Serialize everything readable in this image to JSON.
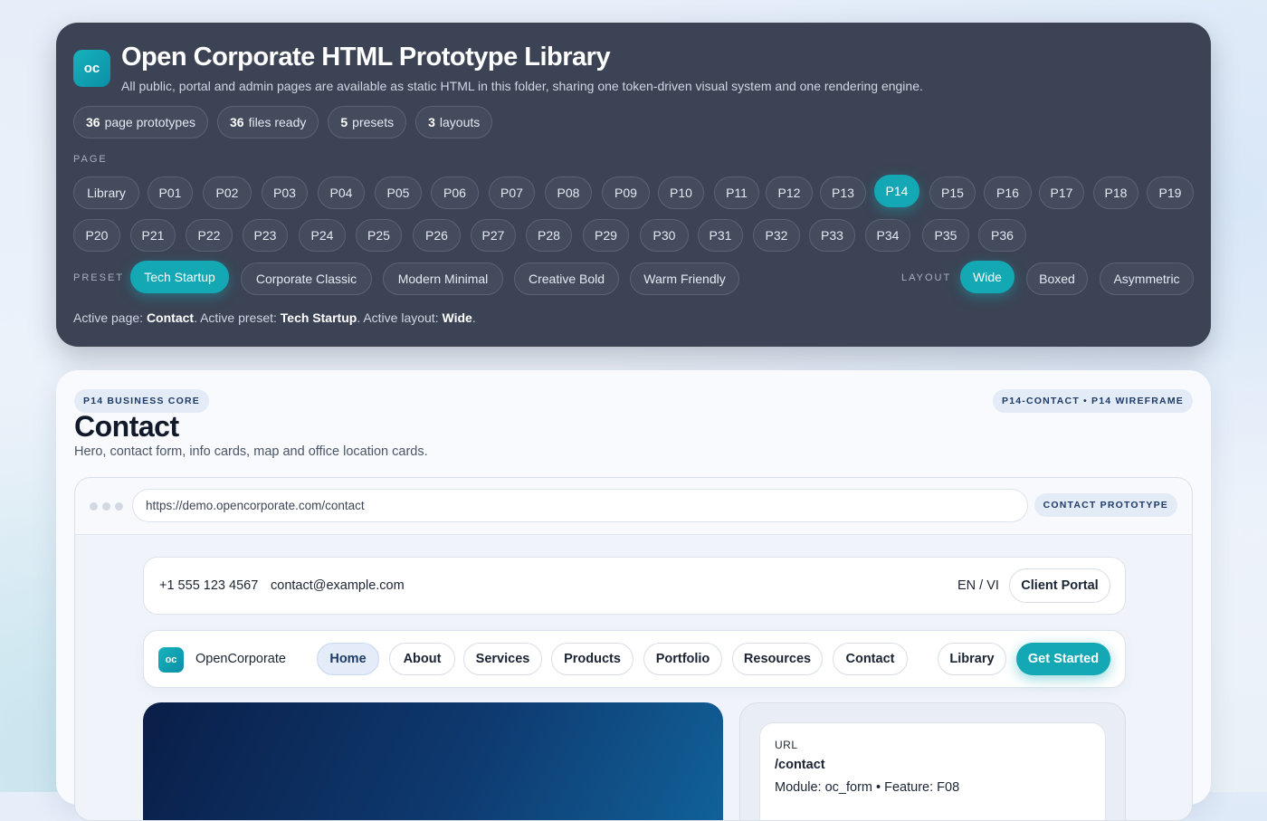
{
  "library": {
    "logo": "oc",
    "title": "Open Corporate HTML Prototype Library",
    "description": "All public, portal and admin pages are available as static HTML in this folder, sharing one token-driven visual system and one rendering engine.",
    "stats": [
      {
        "count": "36",
        "label": "page prototypes"
      },
      {
        "count": "36",
        "label": "files ready"
      },
      {
        "count": "5",
        "label": "presets"
      },
      {
        "count": "3",
        "label": "layouts"
      }
    ],
    "page_label": "PAGE",
    "pages": [
      "Library",
      "P01",
      "P02",
      "P03",
      "P04",
      "P05",
      "P06",
      "P07",
      "P08",
      "P09",
      "P10",
      "P11",
      "P12",
      "P13",
      "P14",
      "P15",
      "P16",
      "P17",
      "P18",
      "P19",
      "P20",
      "P21",
      "P22",
      "P23",
      "P24",
      "P25",
      "P26",
      "P27",
      "P28",
      "P29",
      "P30",
      "P31",
      "P32",
      "P33",
      "P34",
      "P35",
      "P36"
    ],
    "active_page": "P14",
    "preset_label": "PRESET",
    "presets": [
      "Tech Startup",
      "Corporate Classic",
      "Modern Minimal",
      "Creative Bold",
      "Warm Friendly"
    ],
    "active_preset": "Tech Startup",
    "layout_label": "LAYOUT",
    "layouts": [
      "Wide",
      "Boxed",
      "Asymmetric"
    ],
    "active_layout": "Wide",
    "status": {
      "page_prefix": "Active page: ",
      "page": "Contact",
      "preset_prefix": ". Active preset: ",
      "preset": "Tech Startup",
      "layout_prefix": ". Active layout: ",
      "layout": "Wide",
      "suffix": "."
    }
  },
  "prototype": {
    "category_tag": "P14 BUSINESS CORE",
    "id_tag": "P14-CONTACT • P14 WIREFRAME",
    "title": "Contact",
    "description": "Hero, contact form, info cards, map and office location cards.",
    "browser": {
      "url": "https://demo.opencorporate.com/contact",
      "tag": "CONTACT PROTOTYPE"
    },
    "topbar": {
      "phone": "+1 555 123 4567",
      "email": "contact@example.com",
      "lang": "EN / VI",
      "portal": "Client Portal"
    },
    "nav": {
      "logo": "oc",
      "brand": "OpenCorporate",
      "items": [
        "Home",
        "About",
        "Services",
        "Products",
        "Portfolio",
        "Resources",
        "Contact"
      ],
      "active": "Home",
      "library": "Library",
      "cta": "Get Started"
    },
    "info": {
      "label": "URL",
      "value": "/contact",
      "module": "Module: oc_form • Feature: F08"
    }
  },
  "colors": {
    "accent": "#14a8b5",
    "panel_bg": "#3b4354",
    "navy": "#1e3a66"
  }
}
